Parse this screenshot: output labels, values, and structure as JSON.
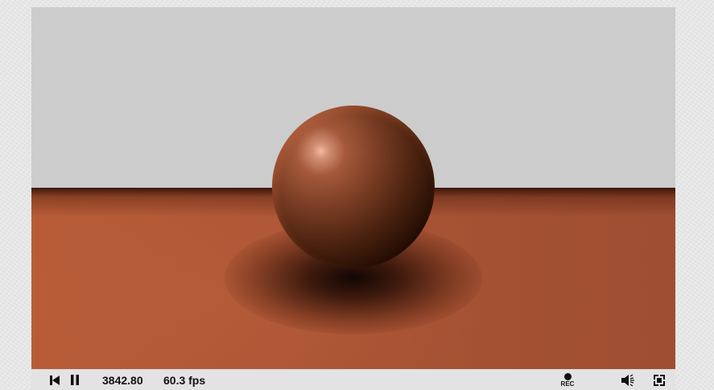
{
  "player": {
    "time_display": "3842.80",
    "fps_display": "60.3 fps",
    "rec_label": "REC",
    "icons": {
      "restart": "skip-back-icon",
      "pause": "pause-icon",
      "record": "record-dot-icon",
      "volume": "volume-icon",
      "fullscreen": "fullscreen-icon"
    },
    "colors": {
      "sky": "#cccccc",
      "floor": "#ae5636",
      "sphere_highlight": "#f2b9a0",
      "controls_bg": "#e3e3e3"
    }
  }
}
